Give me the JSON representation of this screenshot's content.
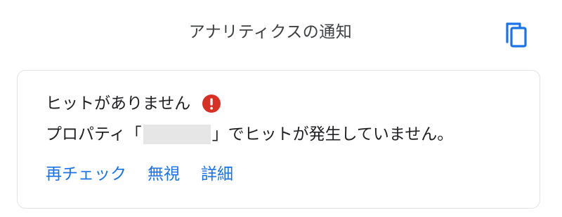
{
  "header": {
    "title": "アナリティクスの通知",
    "copy_icon": "copy-icon"
  },
  "notification": {
    "status_title": "ヒットがありません",
    "status_icon": "error-icon",
    "status_color": "#d93025",
    "message_prefix": "プロパティ「",
    "message_suffix": "」でヒットが発生していません。",
    "actions": [
      {
        "label": "再チェック"
      },
      {
        "label": "無視"
      },
      {
        "label": "詳細"
      }
    ]
  },
  "colors": {
    "accent": "#1a73e8",
    "error": "#d93025",
    "text": "#202124",
    "border": "#e3e3e3"
  }
}
